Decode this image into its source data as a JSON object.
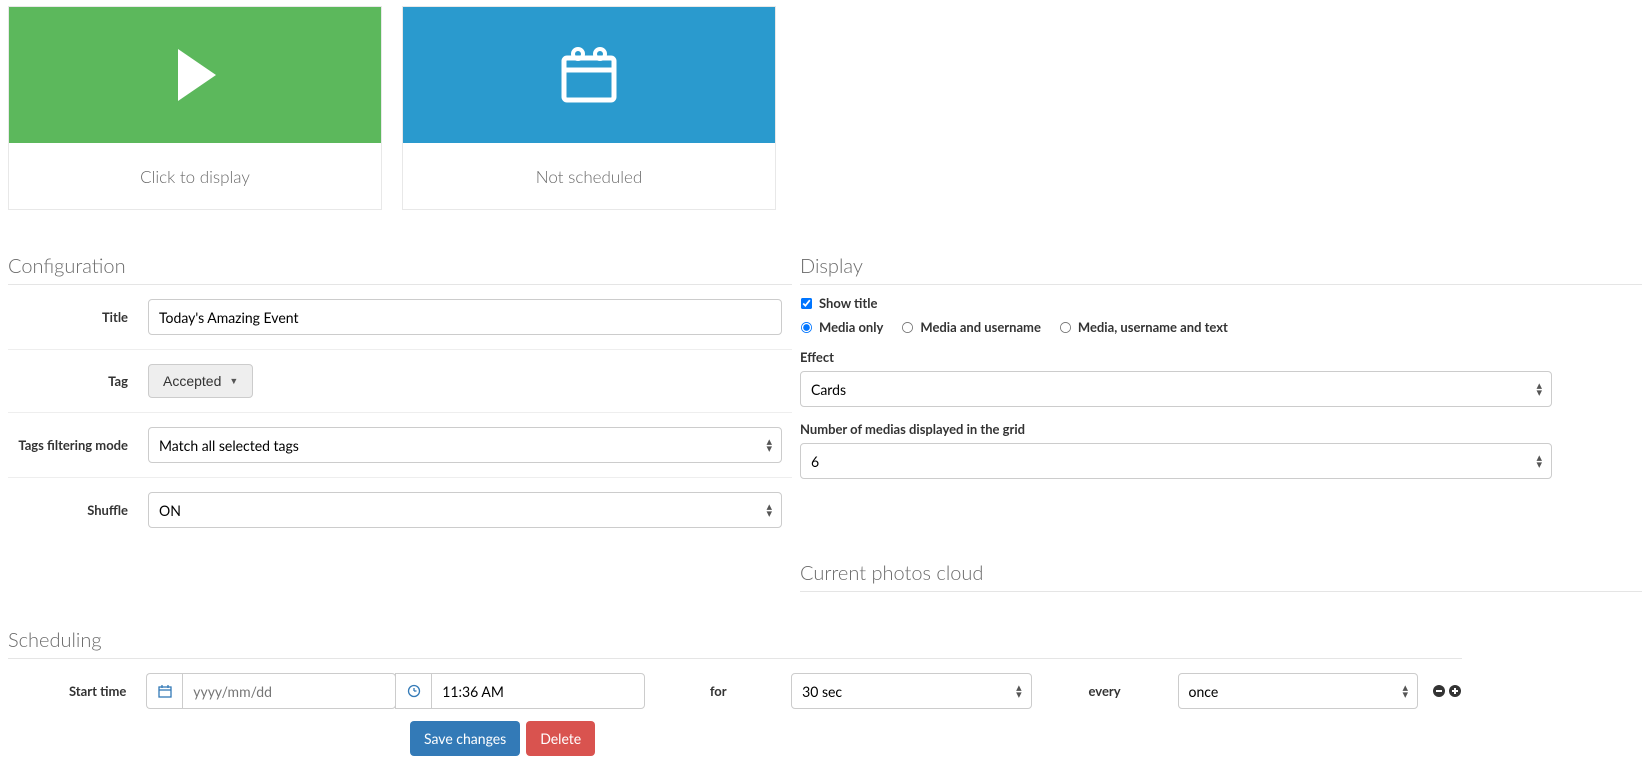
{
  "cards": {
    "display": {
      "caption": "Click to display"
    },
    "schedule": {
      "caption": "Not scheduled"
    }
  },
  "config": {
    "heading": "Configuration",
    "title_label": "Title",
    "title_value": "Today's Amazing Event",
    "tag_label": "Tag",
    "tag_button": "Accepted",
    "filter_label": "Tags filtering mode",
    "filter_value": "Match all selected tags",
    "shuffle_label": "Shuffle",
    "shuffle_value": "ON"
  },
  "display": {
    "heading": "Display",
    "show_title": "Show title",
    "show_title_checked": true,
    "radio": {
      "media_only": "Media only",
      "media_username": "Media and username",
      "media_username_text": "Media, username and text",
      "selected": "media_only"
    },
    "effect_label": "Effect",
    "effect_value": "Cards",
    "num_label": "Number of medias displayed in the grid",
    "num_value": "6"
  },
  "photos": {
    "heading": "Current photos cloud"
  },
  "scheduling": {
    "heading": "Scheduling",
    "start_label": "Start time",
    "date_placeholder": "yyyy/mm/dd",
    "time_value": "11:36 AM",
    "for_label": "for",
    "for_value": "30 sec",
    "every_label": "every",
    "every_value": "once"
  },
  "actions": {
    "save": "Save changes",
    "delete": "Delete"
  },
  "colors": {
    "green": "#5cb85c",
    "blue": "#2a9ace",
    "primary": "#337ab7",
    "danger": "#d9534f"
  }
}
